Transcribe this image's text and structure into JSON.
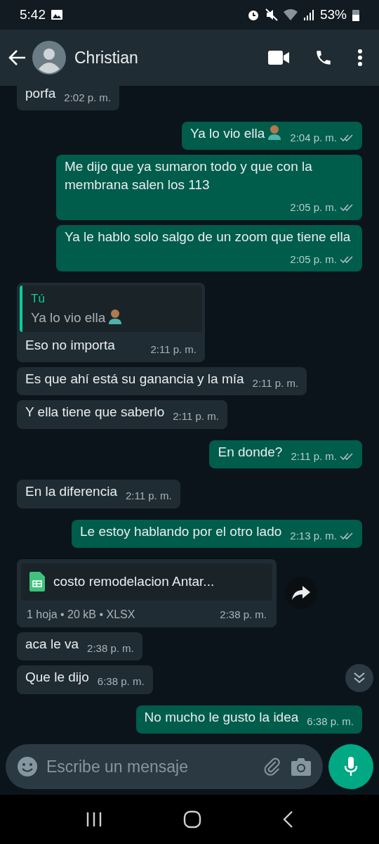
{
  "status_bar": {
    "time": "5:42",
    "battery": "53%"
  },
  "header": {
    "contact": "Christian"
  },
  "messages": [
    {
      "kind": "in",
      "text": "porfa",
      "time": "2:02 p. m."
    },
    {
      "kind": "out",
      "text": "Ya lo vio ella",
      "time": "2:04 p. m.",
      "emoji": true,
      "ticks": true
    },
    {
      "kind": "out",
      "text": "Me dijo que ya sumaron todo y que con  la membrana salen los 113",
      "time": "2:05 p. m.",
      "emoji": false,
      "ticks": true
    },
    {
      "kind": "out",
      "text": "Ya le hablo solo salgo de un zoom que tiene ella",
      "time": "2:05 p. m.",
      "emoji": false,
      "ticks": true
    },
    {
      "kind": "reply_in",
      "quote_author": "Tú",
      "quote_text": "Ya lo vio ella",
      "quote_emoji": true,
      "text": "Eso no importa",
      "time": "2:11 p. m."
    },
    {
      "kind": "in",
      "text": "Es que ahí está su ganancia y la mía",
      "time": "2:11 p. m."
    },
    {
      "kind": "in",
      "text": "Y ella tiene que saberlo",
      "time": "2:11 p. m."
    },
    {
      "kind": "out",
      "text": "En donde?",
      "time": "2:11 p. m.",
      "emoji": false,
      "ticks": true
    },
    {
      "kind": "in",
      "text": "En la diferencia",
      "time": "2:11 p. m."
    },
    {
      "kind": "out",
      "text": "Le estoy hablando por el otro lado",
      "time": "2:13 p. m.",
      "emoji": false,
      "ticks": true
    },
    {
      "kind": "file_in",
      "file_name": "costo remodelacion Antar...",
      "meta": "1 hoja • 20 kB • XLSX",
      "time": "2:38 p. m."
    },
    {
      "kind": "in",
      "text": "aca le va",
      "time": "2:38 p. m."
    },
    {
      "kind": "in",
      "text": "Que le  dijo",
      "time": "6:38 p. m."
    },
    {
      "kind": "out",
      "text": "No mucho le gusto la idea",
      "time": "6:38 p. m.",
      "emoji": false,
      "ticks": false
    }
  ],
  "composer": {
    "placeholder": "Escribe un mensaje"
  }
}
